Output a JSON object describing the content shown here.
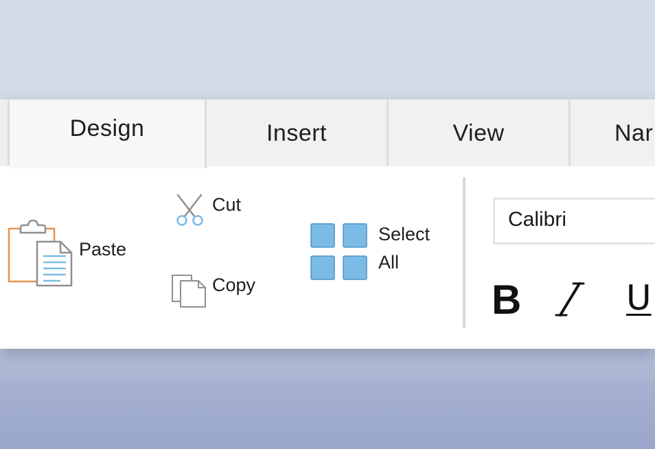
{
  "tabs": [
    {
      "label": "Design",
      "active": true
    },
    {
      "label": "Insert",
      "active": false
    },
    {
      "label": "View",
      "active": false
    },
    {
      "label": "Nar",
      "active": false
    }
  ],
  "clipboard": {
    "paste_label": "Paste",
    "cut_label": "Cut",
    "copy_label": "Copy",
    "select_all_line1": "Select",
    "select_all_line2": "All"
  },
  "font": {
    "family_value": "Calibri",
    "bold_label": "B",
    "italic_label": "I",
    "underline_label": "U"
  },
  "icons": {
    "paste": "clipboard-paste-icon",
    "cut": "scissors-icon",
    "copy": "copy-icon",
    "select_all": "select-all-grid-icon"
  },
  "colors": {
    "clipboard_orange": "#e8924a",
    "accent_blue": "#7bbbe6",
    "accent_blue_border": "#4b93cc"
  }
}
